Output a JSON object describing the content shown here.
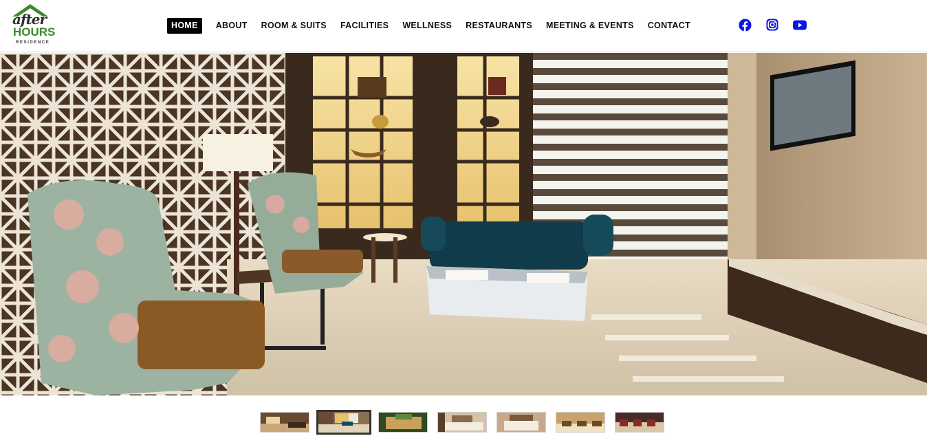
{
  "brand": {
    "logo_line1": "after",
    "logo_line2": "HOURS",
    "logo_line3": "RESIDENCE",
    "green": "#3c8a2e"
  },
  "nav": {
    "items": [
      {
        "label": "HOME",
        "active": true
      },
      {
        "label": "ABOUT"
      },
      {
        "label": "ROOM & SUITS"
      },
      {
        "label": "FACILITIES"
      },
      {
        "label": "WELLNESS"
      },
      {
        "label": "RESTAURANTS"
      },
      {
        "label": "MEETING & EVENTS"
      },
      {
        "label": "CONTACT"
      }
    ]
  },
  "social": {
    "icons": [
      "facebook-icon",
      "instagram-icon",
      "youtube-icon"
    ],
    "color": "#0b14e8"
  },
  "hero": {
    "description_icon": "hotel-lobby-photo"
  },
  "gallery": {
    "count": 7,
    "selected_index": 1
  }
}
